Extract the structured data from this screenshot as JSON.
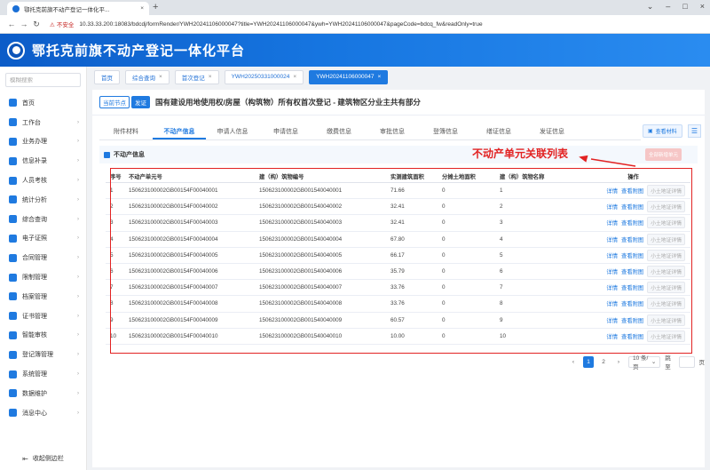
{
  "browser": {
    "tab_title": "鄂托克前旗不动产登记一体化平...",
    "security_label": "不安全",
    "url": "10.33.33.200:18083/bdcdj/formRender/YWH20241106000047?title=YWH20241106000047&ywh=YWH20241106000047&pageCode=bdcq_fw&readOnly=true"
  },
  "app": {
    "title": "鄂托克前旗不动产登记一体化平台"
  },
  "sidebar": {
    "search_placeholder": "模糊搜索",
    "items": [
      {
        "label": "首页",
        "arrow": ""
      },
      {
        "label": "工作台",
        "arrow": "›"
      },
      {
        "label": "业务办理",
        "arrow": "›"
      },
      {
        "label": "信息补录",
        "arrow": "›"
      },
      {
        "label": "人员考核",
        "arrow": "›"
      },
      {
        "label": "统计分析",
        "arrow": "›"
      },
      {
        "label": "综合查询",
        "arrow": "›"
      },
      {
        "label": "电子证照",
        "arrow": "›"
      },
      {
        "label": "合同管理",
        "arrow": "›"
      },
      {
        "label": "限制管理",
        "arrow": "›"
      },
      {
        "label": "档案管理",
        "arrow": "›"
      },
      {
        "label": "证书管理",
        "arrow": "›"
      },
      {
        "label": "智能审核",
        "arrow": "›"
      },
      {
        "label": "登记簿管理",
        "arrow": "›"
      },
      {
        "label": "系统管理",
        "arrow": "›"
      },
      {
        "label": "数据维护",
        "arrow": "›"
      },
      {
        "label": "消息中心",
        "arrow": "›"
      }
    ],
    "collapse_label": "收起侧边栏"
  },
  "page_tabs": [
    {
      "label": "首页",
      "closable": false
    },
    {
      "label": "综合查询",
      "closable": true
    },
    {
      "label": "首次登记",
      "closable": true
    },
    {
      "label": "YWH20250331000024",
      "closable": true
    },
    {
      "label": "YWH20241106000047",
      "closable": true
    }
  ],
  "node": {
    "tag": "当前节点",
    "stage": "发证",
    "title": "国有建设用地使用权/房屋（构筑物）所有权首次登记 - 建筑物区分业主共有部分"
  },
  "sub_tabs": [
    "附件材料",
    "不动产信息",
    "申请人信息",
    "申请信息",
    "缴费信息",
    "审批信息",
    "登簿信息",
    "缮证信息",
    "发证信息"
  ],
  "view_material_label": "查看材料",
  "section_title": "不动产信息",
  "add_button_label": "全部新增单元",
  "annotation": "不动产单元关联列表",
  "table": {
    "headers": [
      "序号",
      "不动产单元号",
      "建（构）筑物编号",
      "实测建筑面积",
      "分摊土地面积",
      "建（构）筑物名称",
      "操作"
    ],
    "rows": [
      [
        "1",
        "150623100002GB00154F00040001",
        "150623100002GB001540040001",
        "71.66",
        "0",
        "1"
      ],
      [
        "2",
        "150623100002GB00154F00040002",
        "150623100002GB001540040002",
        "32.41",
        "0",
        "2"
      ],
      [
        "3",
        "150623100002GB00154F00040003",
        "150623100002GB001540040003",
        "32.41",
        "0",
        "3"
      ],
      [
        "4",
        "150623100002GB00154F00040004",
        "150623100002GB001540040004",
        "67.80",
        "0",
        "4"
      ],
      [
        "5",
        "150623100002GB00154F00040005",
        "150623100002GB001540040005",
        "66.17",
        "0",
        "5"
      ],
      [
        "6",
        "150623100002GB00154F00040006",
        "150623100002GB001540040006",
        "35.79",
        "0",
        "6"
      ],
      [
        "7",
        "150623100002GB00154F00040007",
        "150623100002GB001540040007",
        "33.76",
        "0",
        "7"
      ],
      [
        "8",
        "150623100002GB00154F00040008",
        "150623100002GB001540040008",
        "33.76",
        "0",
        "8"
      ],
      [
        "9",
        "150623100002GB00154F00040009",
        "150623100002GB001540040009",
        "60.57",
        "0",
        "9"
      ],
      [
        "10",
        "150623100002GB00154F00040010",
        "150623100002GB001540040010",
        "10.00",
        "0",
        "10"
      ]
    ],
    "actions": [
      "详情",
      "查看附图",
      "小土地证详情"
    ]
  },
  "pager": {
    "prev": "‹",
    "pages": [
      "1",
      "2"
    ],
    "current": "1",
    "next": "›",
    "page_size": "10 条/页",
    "goto_label": "跳至",
    "page_suffix": "页"
  },
  "colors": {
    "accent": "#1f7ae0",
    "annotation": "#e22222",
    "header": "#1675e0"
  },
  "icons": {
    "back": "←",
    "forward": "→",
    "reload": "↻",
    "close": "×",
    "new_tab": "+",
    "minimize": "–",
    "maximize": "□",
    "dropdown": "⌄",
    "collapse": "⇤",
    "menu": "☰",
    "warning": "⚠",
    "view_material": "▣"
  }
}
